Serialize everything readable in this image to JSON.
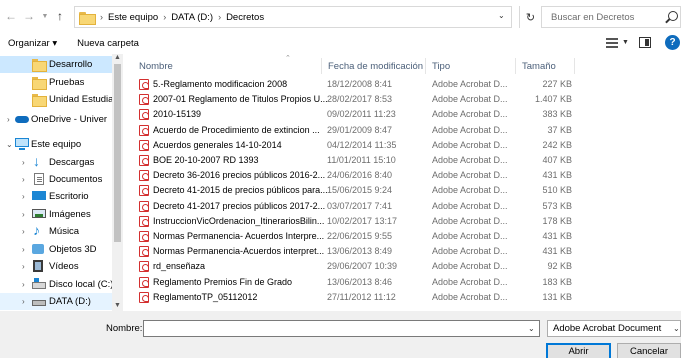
{
  "address": {
    "crumbs": [
      "Este equipo",
      "DATA (D:)",
      "Decretos"
    ],
    "search_placeholder": "Buscar en Decretos"
  },
  "toolbar": {
    "organize_label": "Organizar ▾",
    "new_folder_label": "Nueva carpeta"
  },
  "sidebar": {
    "items": [
      {
        "label": "Desarrollo",
        "icon": "folder-icon",
        "selected": true
      },
      {
        "label": "Pruebas",
        "icon": "folder-icon"
      },
      {
        "label": "Unidad Estudian",
        "icon": "folder-icon"
      },
      {
        "label": "OneDrive - Univer",
        "icon": "cloud-icon"
      },
      {
        "label": "Este equipo",
        "icon": "computer-icon"
      },
      {
        "label": "Descargas",
        "icon": "download-icon"
      },
      {
        "label": "Documentos",
        "icon": "document-icon"
      },
      {
        "label": "Escritorio",
        "icon": "desktop-icon"
      },
      {
        "label": "Imágenes",
        "icon": "image-icon"
      },
      {
        "label": "Música",
        "icon": "music-icon"
      },
      {
        "label": "Objetos 3D",
        "icon": "cube-icon"
      },
      {
        "label": "Vídeos",
        "icon": "video-icon"
      },
      {
        "label": "Disco local (C:)",
        "icon": "disk-icon"
      },
      {
        "label": "DATA (D:)",
        "icon": "drive-icon"
      }
    ]
  },
  "columns": {
    "name": "Nombre",
    "date": "Fecha de modificación",
    "type": "Tipo",
    "size": "Tamaño"
  },
  "files": [
    {
      "name": "5.-Reglamento modificacion 2008",
      "date": "18/12/2008 8:41",
      "type": "Adobe Acrobat D...",
      "size": "227 KB"
    },
    {
      "name": "2007-01 Reglamento de Titulos Propios U...",
      "date": "28/02/2017 8:53",
      "type": "Adobe Acrobat D...",
      "size": "1.407 KB"
    },
    {
      "name": "2010-15139",
      "date": "09/02/2011 11:23",
      "type": "Adobe Acrobat D...",
      "size": "383 KB"
    },
    {
      "name": "Acuerdo de Procedimiento de extincion ...",
      "date": "29/01/2009 8:47",
      "type": "Adobe Acrobat D...",
      "size": "37 KB"
    },
    {
      "name": "Acuerdos generales 14-10-2014",
      "date": "04/12/2014 11:35",
      "type": "Adobe Acrobat D...",
      "size": "242 KB"
    },
    {
      "name": "BOE 20-10-2007 RD 1393",
      "date": "11/01/2011 15:10",
      "type": "Adobe Acrobat D...",
      "size": "407 KB"
    },
    {
      "name": "Decreto 36-2016 precios públicos 2016-2...",
      "date": "24/06/2016 8:40",
      "type": "Adobe Acrobat D...",
      "size": "431 KB"
    },
    {
      "name": "Decreto 41-2015 de precios públicos para...",
      "date": "15/06/2015 9:24",
      "type": "Adobe Acrobat D...",
      "size": "510 KB"
    },
    {
      "name": "Decreto 41-2017 precios públicos 2017-2...",
      "date": "03/07/2017 7:41",
      "type": "Adobe Acrobat D...",
      "size": "573 KB"
    },
    {
      "name": "InstruccionVicOrdenacion_ItinerariosBilin...",
      "date": "10/02/2017 13:17",
      "type": "Adobe Acrobat D...",
      "size": "178 KB"
    },
    {
      "name": "Normas Permanencia- Acuerdos Interpre...",
      "date": "22/06/2015 9:55",
      "type": "Adobe Acrobat D...",
      "size": "431 KB"
    },
    {
      "name": "Normas Permanencia-Acuerdos interpret...",
      "date": "13/06/2013 8:49",
      "type": "Adobe Acrobat D...",
      "size": "431 KB"
    },
    {
      "name": "rd_enseñaza",
      "date": "29/06/2007 10:39",
      "type": "Adobe Acrobat D...",
      "size": "92 KB"
    },
    {
      "name": "Reglamento Premios Fin de Grado",
      "date": "13/06/2013 8:46",
      "type": "Adobe Acrobat D...",
      "size": "183 KB"
    },
    {
      "name": "ReglamentoTP_05112012",
      "date": "27/11/2012 11:12",
      "type": "Adobe Acrobat D...",
      "size": "131 KB"
    }
  ],
  "bottom": {
    "name_label": "Nombre:",
    "name_value": "",
    "filter_value": "Adobe Acrobat Document",
    "open_label": "Abrir",
    "cancel_label": "Cancelar"
  },
  "colors": {
    "selection": "#cce8ff",
    "accent": "#0078d7",
    "pdf_red": "#d32f2f"
  }
}
